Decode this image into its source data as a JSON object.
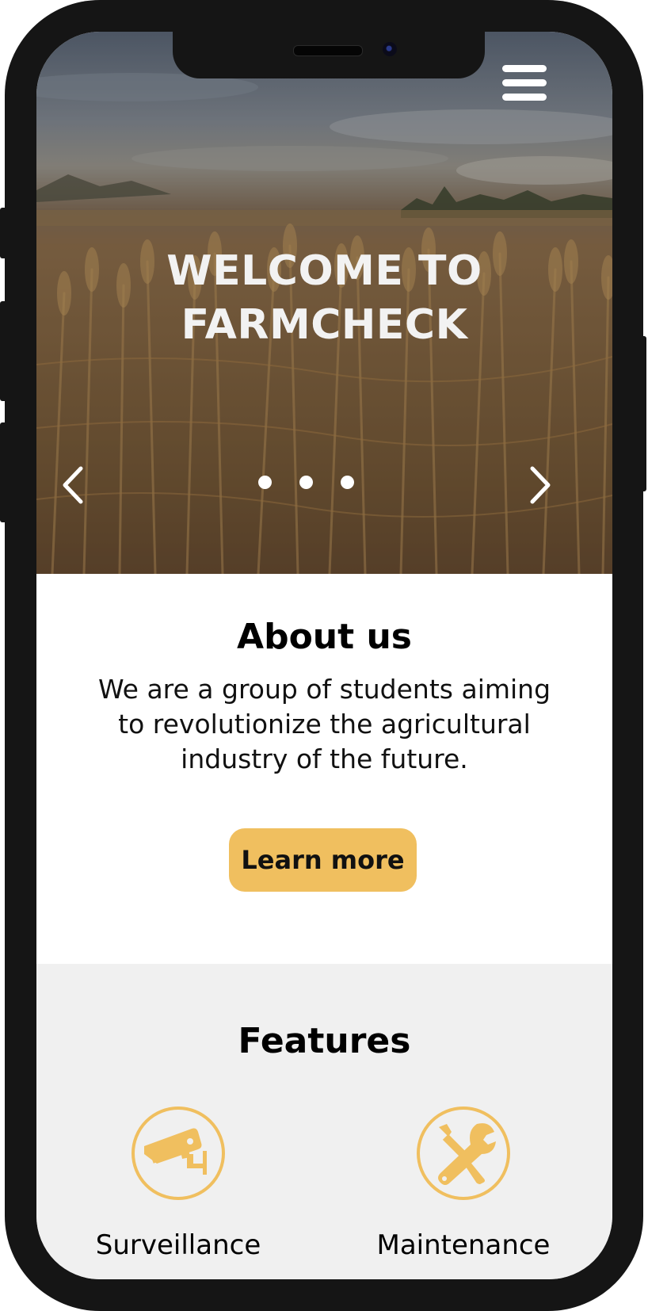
{
  "colors": {
    "accent": "#f0bf5f",
    "phone_frame": "#151515",
    "features_bg": "#f0f0f0",
    "hero_text": "#f2f2f2"
  },
  "nav": {
    "menu_icon": "hamburger-menu-icon"
  },
  "hero": {
    "title_line1": "WELCOME TO",
    "title_line2": "FARMCHECK",
    "background": "wheat field photo",
    "prev_icon": "chevron-left-icon",
    "next_icon": "chevron-right-icon",
    "slide_count": 3
  },
  "about": {
    "title": "About us",
    "text": "We are a group of students aiming to revolutionize the agricultural industry of the future.",
    "button_label": "Learn more"
  },
  "features": {
    "title": "Features",
    "items": [
      {
        "label": "Surveillance",
        "icon": "security-camera-icon"
      },
      {
        "label": "Maintenance",
        "icon": "wrench-screwdriver-icon"
      }
    ]
  }
}
